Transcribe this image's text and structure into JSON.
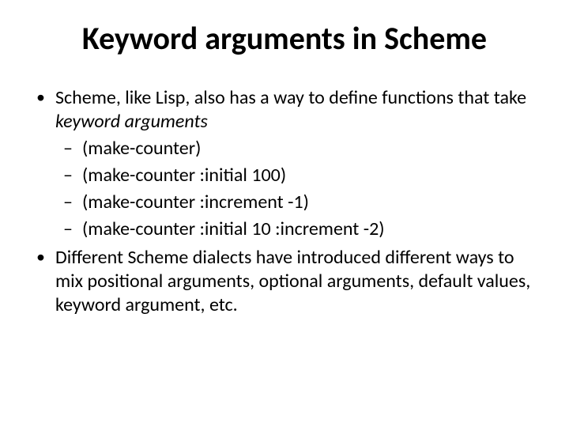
{
  "title": "Keyword arguments in Scheme",
  "bullets": [
    {
      "pre": "Scheme, like Lisp, also has a way to define functions that take ",
      "em": "keyword arguments",
      "post": "",
      "sub": [
        "(make-counter)",
        "(make-counter :initial 100)",
        "(make-counter :increment -1)",
        "(make-counter :initial 10 :increment -2)"
      ]
    },
    {
      "pre": "Different Scheme dialects have introduced different ways to mix positional arguments, optional arguments, default values, keyword argument, etc.",
      "em": "",
      "post": "",
      "sub": []
    }
  ]
}
